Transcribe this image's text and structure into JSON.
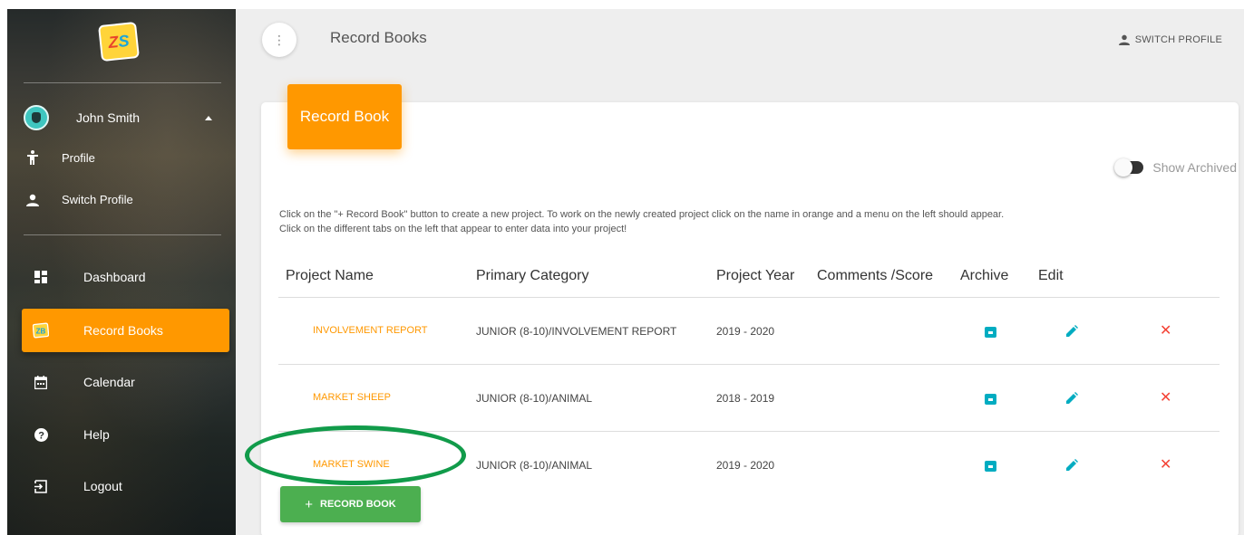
{
  "sidebar": {
    "logo_text_a": "Z",
    "logo_text_b": "S",
    "user": {
      "name": "John Smith"
    },
    "user_menu": [
      {
        "label": "Profile",
        "icon": "person-standing-icon"
      },
      {
        "label": "Switch Profile",
        "icon": "person-icon"
      }
    ],
    "nav": [
      {
        "label": "Dashboard",
        "icon": "dashboard-icon"
      },
      {
        "label": "Record Books",
        "icon": "zs-record-books-icon",
        "active": true
      },
      {
        "label": "Calendar",
        "icon": "calendar-icon"
      },
      {
        "label": "Help",
        "icon": "help-icon"
      },
      {
        "label": "Logout",
        "icon": "logout-icon"
      }
    ]
  },
  "topbar": {
    "menu_glyph": "⋮",
    "title": "Record Books",
    "switch_profile": "SWITCH PROFILE"
  },
  "card": {
    "header": "Record Book",
    "show_archived_label": "Show Archived",
    "instructions": [
      "Click on the \"+ Record Book\" button to create a new project. To work on the newly created project click on the name in orange and a menu on the left should appear.",
      "Click on the different tabs on the left that appear to enter data into your project!"
    ],
    "columns": [
      "Project Name",
      "Primary Category",
      "Project Year",
      "Comments /Score",
      "Archive",
      "Edit"
    ],
    "rows": [
      {
        "name": "INVOLVEMENT REPORT",
        "category": "JUNIOR (8-10)/INVOLVEMENT REPORT",
        "year": "2019 - 2020",
        "comments": ""
      },
      {
        "name": "MARKET SHEEP",
        "category": "JUNIOR (8-10)/ANIMAL",
        "year": "2018 - 2019",
        "comments": ""
      },
      {
        "name": "MARKET SWINE",
        "category": "JUNIOR (8-10)/ANIMAL",
        "year": "2019 - 2020",
        "comments": ""
      }
    ],
    "add_button": "RECORD BOOK",
    "add_button_plus": "+",
    "delete_glyph": "✕"
  },
  "colors": {
    "accent": "#ff9800",
    "archive": "#00acc1",
    "delete": "#f44336",
    "add_button": "#4caf50",
    "highlight": "#119b4a"
  }
}
